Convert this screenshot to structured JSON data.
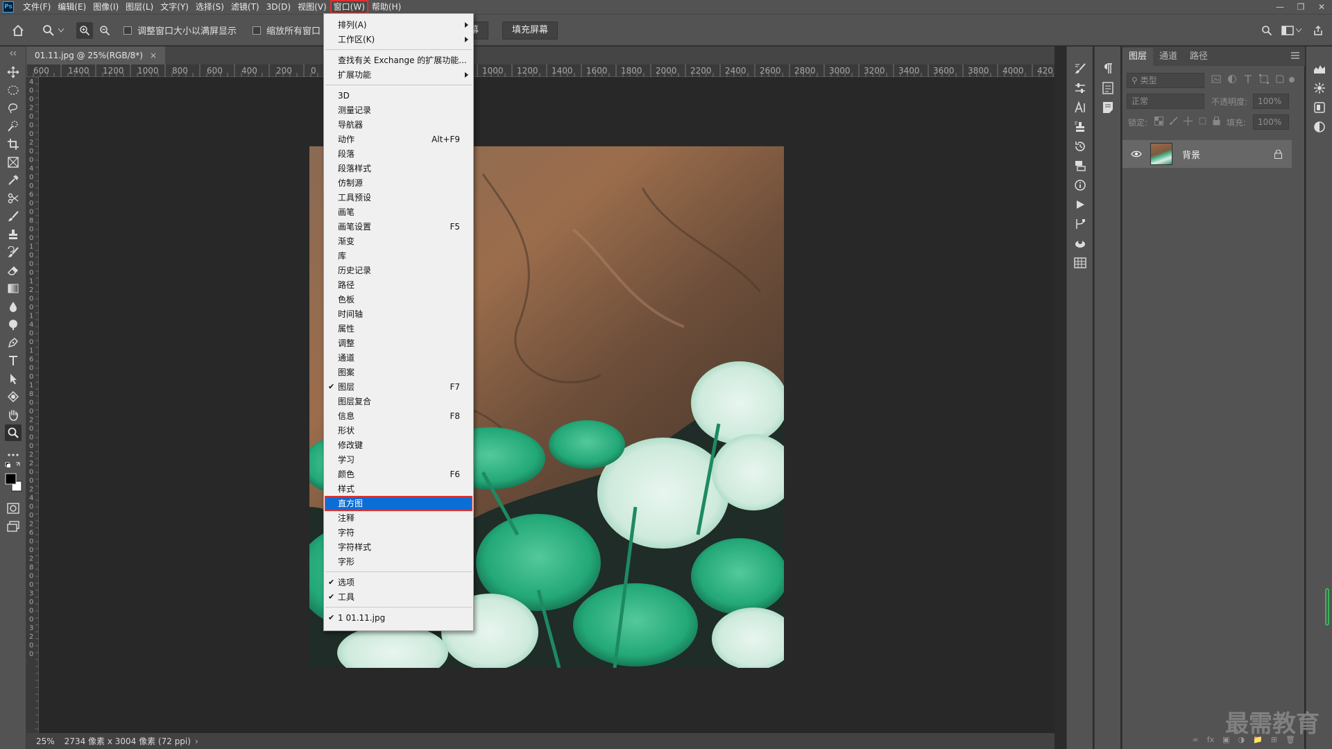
{
  "menubar": {
    "items": [
      "文件(F)",
      "编辑(E)",
      "图像(I)",
      "图层(L)",
      "文字(Y)",
      "选择(S)",
      "滤镜(T)",
      "3D(D)",
      "视图(V)",
      "窗口(W)",
      "帮助(H)"
    ],
    "active_index": 9
  },
  "options": {
    "resize_windows_label": "调整窗口大小以满屏显示",
    "zoom_all_windows_label": "缩放所有窗口",
    "fit_screen_label": "屏幕",
    "fill_screen_label": "填充屏幕"
  },
  "document": {
    "tab_title": "01.11.jpg @ 25%(RGB/8*)",
    "zoom": "25%",
    "status": "2734 像素 x 3004 像素 (72 ppi)"
  },
  "rulers": {
    "h_left": [
      "600",
      "1400",
      "1200",
      "1000",
      "800",
      "600",
      "400",
      "200",
      "0"
    ],
    "h_right": [
      "1000",
      "1200",
      "1400",
      "1600",
      "1800",
      "2000",
      "2200",
      "2400",
      "2600",
      "2800",
      "3000",
      "3200",
      "3400",
      "3600",
      "3800",
      "4000",
      "420"
    ],
    "v": [
      "4",
      "0",
      "0",
      "2",
      "0",
      "0",
      "0",
      "2",
      "0",
      "0",
      "4",
      "0",
      "0",
      "6",
      "0",
      "0",
      "8",
      "0",
      "0",
      "1",
      "0",
      "0",
      "0",
      "1",
      "2",
      "0",
      "0",
      "1",
      "4",
      "0",
      "0",
      "1",
      "6",
      "0",
      "0",
      "1",
      "8",
      "0",
      "0",
      "2",
      "0",
      "0",
      "0",
      "2",
      "2",
      "0",
      "0",
      "2",
      "4",
      "0",
      "0",
      "2",
      "6",
      "0",
      "0",
      "2",
      "8",
      "0",
      "0",
      "3",
      "0",
      "0",
      "0",
      "3",
      "2",
      "0",
      "0"
    ]
  },
  "window_menu": {
    "items": [
      {
        "label": "排列(A)",
        "submenu": true,
        "sep_after": false
      },
      {
        "label": "工作区(K)",
        "submenu": true,
        "sep_after": true
      },
      {
        "label": "查找有关 Exchange 的扩展功能...",
        "sep_after": false
      },
      {
        "label": "扩展功能",
        "submenu": true,
        "sep_after": true
      },
      {
        "label": "3D"
      },
      {
        "label": "测量记录"
      },
      {
        "label": "导航器"
      },
      {
        "label": "动作",
        "shortcut": "Alt+F9"
      },
      {
        "label": "段落"
      },
      {
        "label": "段落样式"
      },
      {
        "label": "仿制源"
      },
      {
        "label": "工具预设"
      },
      {
        "label": "画笔"
      },
      {
        "label": "画笔设置",
        "shortcut": "F5"
      },
      {
        "label": "渐变"
      },
      {
        "label": "库"
      },
      {
        "label": "历史记录"
      },
      {
        "label": "路径"
      },
      {
        "label": "色板"
      },
      {
        "label": "时间轴"
      },
      {
        "label": "属性"
      },
      {
        "label": "调整"
      },
      {
        "label": "通道"
      },
      {
        "label": "图案"
      },
      {
        "label": "图层",
        "shortcut": "F7",
        "checked": true
      },
      {
        "label": "图层复合"
      },
      {
        "label": "信息",
        "shortcut": "F8"
      },
      {
        "label": "形状"
      },
      {
        "label": "修改键"
      },
      {
        "label": "学习"
      },
      {
        "label": "颜色",
        "shortcut": "F6"
      },
      {
        "label": "样式"
      },
      {
        "label": "直方图",
        "highlighted": true
      },
      {
        "label": "注释"
      },
      {
        "label": "字符"
      },
      {
        "label": "字符样式"
      },
      {
        "label": "字形",
        "sep_after": true
      },
      {
        "label": "选项",
        "checked": true
      },
      {
        "label": "工具",
        "checked": true,
        "sep_after": true
      },
      {
        "label": "1 01.11.jpg",
        "checked": true
      }
    ]
  },
  "layers_panel": {
    "tabs": [
      "图层",
      "通道",
      "路径"
    ],
    "active_tab": 0,
    "filter_placeholder": "类型",
    "blend_mode": "正常",
    "opacity_label": "不透明度:",
    "opacity_value": "100%",
    "lock_label": "锁定:",
    "fill_label": "填充:",
    "fill_value": "100%",
    "layers": [
      {
        "name": "背景",
        "visible": true,
        "locked": true
      }
    ]
  },
  "watermark": "最需教育",
  "colors": {
    "highlight": "#0b6ed6",
    "accent_red": "#e03030",
    "ui_dark": "#535353"
  }
}
